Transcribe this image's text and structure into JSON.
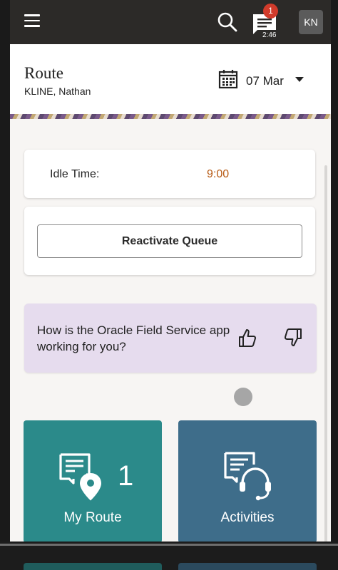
{
  "appbar": {
    "menu_icon": "hamburger-menu-icon",
    "search_icon": "search-icon",
    "chat_icon": "chat-icon",
    "chat_badge": "1",
    "chat_time": "2:46",
    "avatar_initials": "KN"
  },
  "header": {
    "title": "Route",
    "subtitle": "KLINE, Nathan",
    "date": "07 Mar",
    "calendar_icon": "calendar-icon",
    "dropdown_icon": "caret-down-icon"
  },
  "idle": {
    "label": "Idle Time:",
    "value": "9:00"
  },
  "queue": {
    "button_label": "Reactivate Queue"
  },
  "feedback": {
    "question": "How is the Oracle Field Service app working for you?",
    "thumbs_up_icon": "thumbs-up-icon",
    "thumbs_down_icon": "thumbs-down-icon"
  },
  "tiles": [
    {
      "label": "My Route",
      "count": "1",
      "icon": "route-map-pin-icon"
    },
    {
      "label": "Activities",
      "icon": "activities-headset-icon"
    }
  ],
  "colors": {
    "appbar": "#2c2a28",
    "badge": "#d13b2b",
    "idle_value": "#b75a14",
    "feedback_bg": "#e6dcee",
    "tile_route": "#2b8a8a",
    "tile_activities": "#3e6d8a"
  }
}
